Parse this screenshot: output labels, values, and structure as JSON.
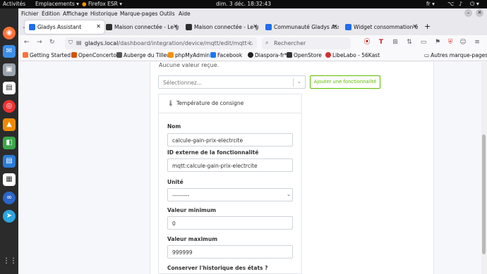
{
  "gnome_bar": {
    "activities": "Activités",
    "emplacements": "Emplacements",
    "firefox": "Firefox ESR",
    "clock": "dim. 3 déc.  18:32:43",
    "lang": "fr"
  },
  "menubar": {
    "items": [
      "Fichier",
      "Édition",
      "Affichage",
      "Historique",
      "Marque-pages",
      "Outils",
      "Aide"
    ]
  },
  "tabs": [
    {
      "title": "Gladys Assistant",
      "active": true
    },
    {
      "title": "Maison connectée - Le gu",
      "active": false
    },
    {
      "title": "Maison connectée - Le gu",
      "active": false
    },
    {
      "title": "Communauté Gladys Assis",
      "active": false
    },
    {
      "title": "Widget consommation él",
      "active": false
    }
  ],
  "navbar": {
    "url_host": "gladys.local",
    "url_path": "/dashboard/integration/device/mqtt/edit/mqtt-ca",
    "search_placeholder": "Rechercher"
  },
  "bookmarks": [
    "Getting Started",
    "OpenConcerto",
    "Auberge du Tilleul",
    "phpMyAdmin",
    "Facebook",
    "Diaspora-fr*",
    "OpenStore",
    "LibeLabo - 56Kast"
  ],
  "bookmarks_other": "Autres marque-pages",
  "page": {
    "no_value": "Aucune valeur reçue.",
    "select_placeholder": "Sélectionnez...",
    "add_feature": "Ajouter une fonctionnalité",
    "feature_title": "Température de consigne",
    "name_label": "Nom",
    "name_value": "calcule-gain-prix-electrcite",
    "ext_id_label": "ID externe de la fonctionnalité",
    "ext_id_value": "mqtt:calcule-gain-prix-electrcite",
    "unit_label": "Unité",
    "unit_value": "---------",
    "min_label": "Valeur minimum",
    "min_value": "0",
    "max_label": "Valeur maximum",
    "max_value": "999999",
    "history_label": "Conserver l'historique des états ?"
  }
}
